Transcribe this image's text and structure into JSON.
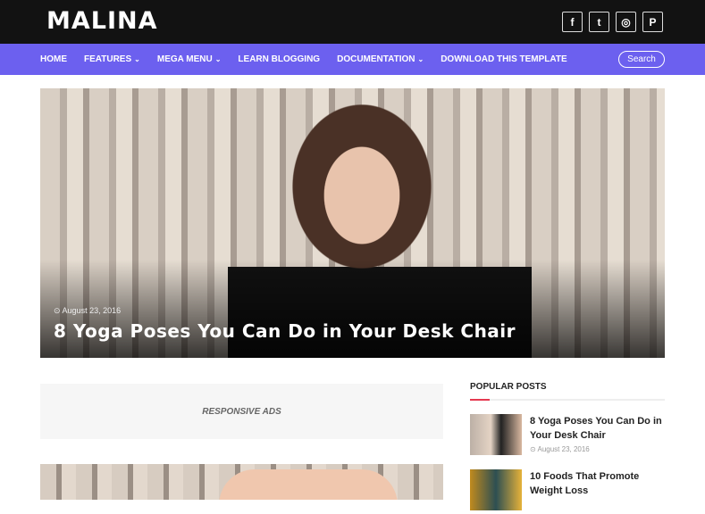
{
  "header": {
    "logo": "MALINA",
    "social": [
      {
        "icon": "facebook-icon",
        "glyph": "f"
      },
      {
        "icon": "twitter-icon",
        "glyph": "t"
      },
      {
        "icon": "instagram-icon",
        "glyph": "◎"
      },
      {
        "icon": "pinterest-icon",
        "glyph": "P"
      }
    ]
  },
  "nav": {
    "items": [
      {
        "label": "HOME",
        "dropdown": false
      },
      {
        "label": "FEATURES",
        "dropdown": true
      },
      {
        "label": "MEGA MENU",
        "dropdown": true
      },
      {
        "label": "LEARN BLOGGING",
        "dropdown": false
      },
      {
        "label": "DOCUMENTATION",
        "dropdown": true
      },
      {
        "label": "DOWNLOAD THIS TEMPLATE",
        "dropdown": false
      }
    ],
    "chevron": "⌄",
    "search_label": "Search"
  },
  "hero": {
    "date": "⊙ August 23, 2016",
    "title": "8 Yoga Poses You Can Do in Your Desk Chair"
  },
  "ads": {
    "label": "RESPONSIVE ADS"
  },
  "sidebar": {
    "title": "POPULAR POSTS",
    "posts": [
      {
        "title": "8 Yoga Poses You Can Do in Your Desk Chair",
        "date": "⊙ August 23, 2016"
      },
      {
        "title": "10 Foods That Promote Weight Loss",
        "date": ""
      }
    ]
  },
  "colors": {
    "nav": "#6c60ef",
    "topbar": "#121212",
    "accent": "#e53950"
  }
}
